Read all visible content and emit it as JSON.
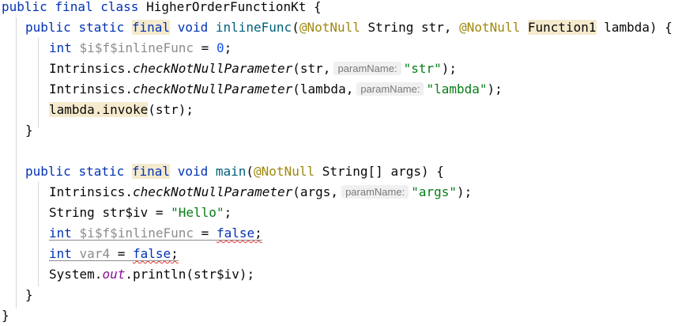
{
  "code": {
    "l1": {
      "kw1": "public",
      "kw2": "final",
      "kw3": "class",
      "name": "HigherOrderFunctionKt",
      "brace": " {"
    },
    "l2": {
      "kw1": "public",
      "kw2": "static",
      "kw3": "final",
      "kw4": "void",
      "method": "inlineFunc",
      "open": "(",
      "ann1": "@NotNull",
      "type1": "String",
      "p1": "str",
      "comma": ", ",
      "ann2": "@NotNull",
      "type2": "Function1",
      "p2": "lambda",
      "close": ") {"
    },
    "l3": {
      "kw": "int",
      "var": "$i$f$inlineFunc",
      "eq": " = ",
      "num": "0",
      "semi": ";"
    },
    "l4": {
      "cls": "Intrinsics.",
      "method": "checkNotNullParameter",
      "open": "(str,",
      "hint": "paramName:",
      "str": "\"str\"",
      "close": ");"
    },
    "l5": {
      "cls": "Intrinsics.",
      "method": "checkNotNullParameter",
      "open": "(lambda,",
      "hint": "paramName:",
      "str": "\"lambda\"",
      "close": ");"
    },
    "l6": {
      "call": "lambda.invoke",
      "rest": "(str);"
    },
    "l7": {
      "brace": "}"
    },
    "l9": {
      "kw1": "public",
      "kw2": "static",
      "kw3": "final",
      "kw4": "void",
      "method": "main",
      "open": "(",
      "ann": "@NotNull",
      "type": "String[]",
      "p": "args",
      "close": ") {"
    },
    "l10": {
      "cls": "Intrinsics.",
      "method": "checkNotNullParameter",
      "open": "(args,",
      "hint": "paramName:",
      "str": "\"args\"",
      "close": ");"
    },
    "l11": {
      "type": "String",
      "var": "str$iv",
      "eq": " = ",
      "str": "\"Hello\"",
      "semi": ";"
    },
    "l12": {
      "kw": "int",
      "var": "$i$f$inlineFunc",
      "eq": " = ",
      "val": "false",
      "semi": ";"
    },
    "l13": {
      "kw": "int",
      "var": "var4",
      "eq": " = ",
      "val": "false",
      "semi": ";"
    },
    "l14": {
      "obj": "System.",
      "field": "out",
      "rest": ".println(str$iv);"
    },
    "l15": {
      "brace": "}"
    },
    "l17": {
      "brace": "}"
    }
  }
}
